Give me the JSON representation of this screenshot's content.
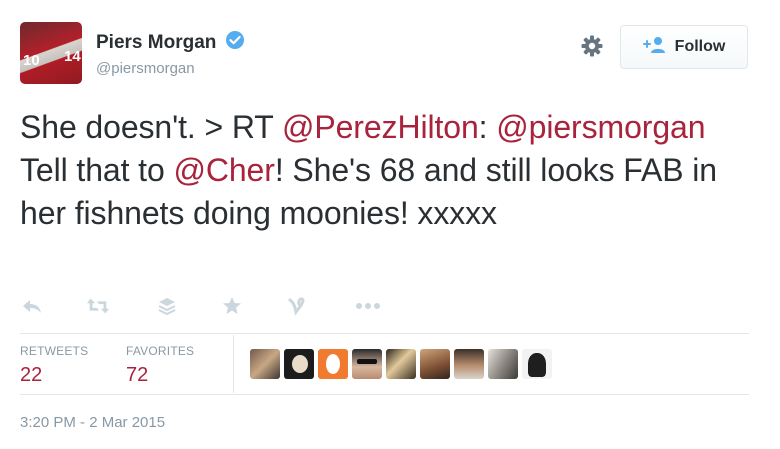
{
  "user": {
    "name": "Piers Morgan",
    "handle": "@piersmorgan"
  },
  "follow_label": "Follow",
  "tweet": {
    "parts": [
      {
        "text": "She doesn't. > RT ",
        "mention": false
      },
      {
        "text": "@PerezHilton",
        "mention": true
      },
      {
        "text": ": ",
        "mention": false
      },
      {
        "text": "@piersmorgan",
        "mention": true
      },
      {
        "text": " Tell that to ",
        "mention": false
      },
      {
        "text": "@Cher",
        "mention": true
      },
      {
        "text": "! She's 68 and still looks FAB in her fishnets doing moonies! xxxxx",
        "mention": false
      }
    ]
  },
  "actions": [
    "reply-icon",
    "retweet-icon",
    "stack-icon",
    "favorite-icon",
    "vine-icon",
    "more-icon"
  ],
  "stats": {
    "retweets_label": "RETWEETS",
    "retweets_value": "22",
    "favorites_label": "FAVORITES",
    "favorites_value": "72"
  },
  "favoriter_avatars": [
    "avatar-1",
    "avatar-2",
    "avatar-3",
    "avatar-4",
    "avatar-5",
    "avatar-6",
    "avatar-7",
    "avatar-8",
    "avatar-9"
  ],
  "timestamp": "3:20 PM - 2 Mar 2015",
  "colors": {
    "mention": "#a8233b",
    "stat_value": "#a8233b",
    "muted": "#8899a6",
    "verified": "#55acee",
    "icon": "#ccd6dd"
  }
}
